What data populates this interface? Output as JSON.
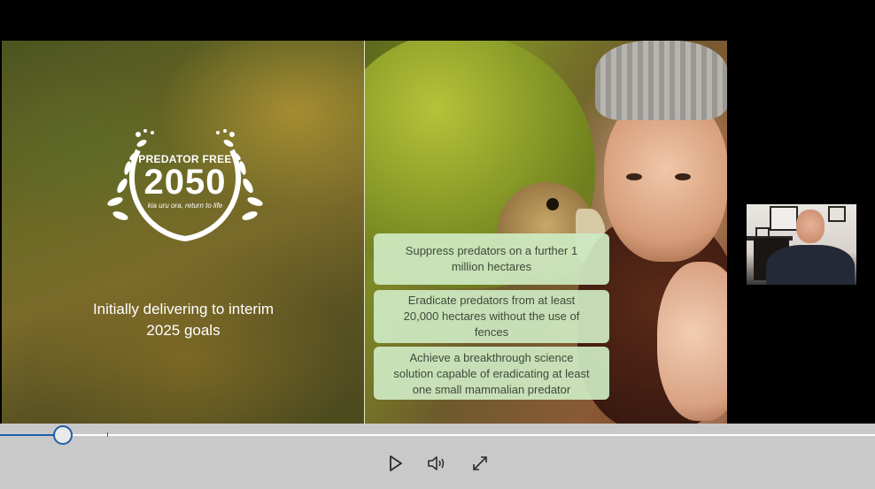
{
  "slide": {
    "logo": {
      "title": "PREDATOR FREE",
      "year": "2050",
      "tagline": "kia uru ora, return to life"
    },
    "left_caption_lines": [
      "Initially delivering to interim",
      "2025 goals"
    ],
    "goals": [
      {
        "lines": [
          "Suppress predators on a further 1",
          "million hectares"
        ]
      },
      {
        "lines": [
          "Eradicate predators from at least",
          "20,000 hectares without the use of",
          "fences"
        ]
      },
      {
        "lines": [
          "Achieve a breakthrough science",
          "solution capable of eradicating at least",
          "one small mammalian predator"
        ]
      }
    ]
  },
  "player": {
    "progress_fraction": 0.072,
    "accent_color": "#1f5fa8",
    "controls_bg": "#c9c9c9",
    "buttons": {
      "play_icon": "play-icon",
      "volume_icon": "volume-icon",
      "fullscreen_icon": "fullscreen-icon"
    }
  }
}
